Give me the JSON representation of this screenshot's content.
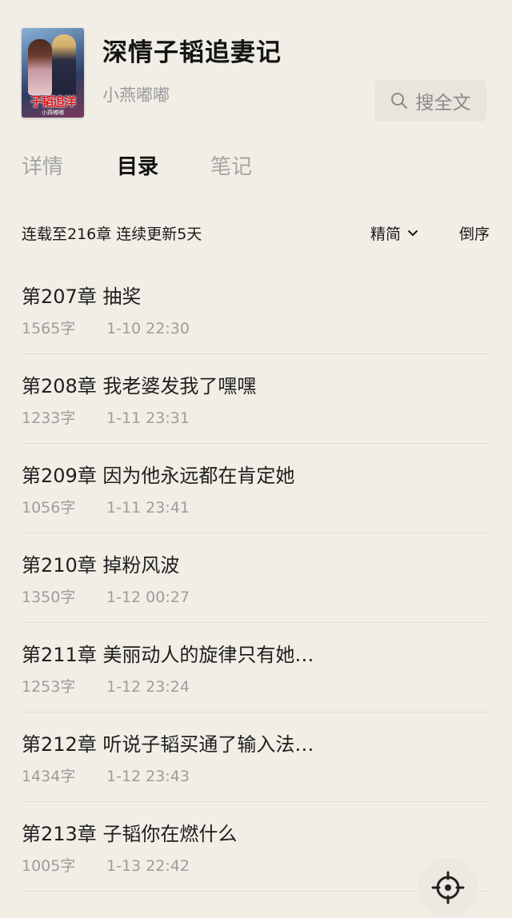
{
  "book": {
    "title": "深情子韬追妻记",
    "author": "小燕嘟嘟",
    "cover_title": "子韬追洋",
    "cover_subtitle": "小燕嘟嘟"
  },
  "search": {
    "label": "搜全文"
  },
  "tabs": [
    {
      "label": "详情",
      "active": false
    },
    {
      "label": "目录",
      "active": true
    },
    {
      "label": "笔记",
      "active": false
    }
  ],
  "toc_info": {
    "status": "连载至216章 连续更新5天",
    "mode": "精简",
    "order": "倒序"
  },
  "chapters": [
    {
      "title": "第207章  抽奖",
      "words": "1565字",
      "time": "1-10 22:30"
    },
    {
      "title": "第208章  我老婆发我了嘿嘿",
      "words": "1233字",
      "time": "1-11 23:31"
    },
    {
      "title": "第209章  因为他永远都在肯定她",
      "words": "1056字",
      "time": "1-11 23:41"
    },
    {
      "title": "第210章  掉粉风波",
      "words": "1350字",
      "time": "1-12 00:27"
    },
    {
      "title": "第211章  美丽动人的旋律只有她…",
      "words": "1253字",
      "time": "1-12 23:24"
    },
    {
      "title": "第212章  听说子韬买通了输入法…",
      "words": "1434字",
      "time": "1-12 23:43"
    },
    {
      "title": "第213章  子韬你在燃什么",
      "words": "1005字",
      "time": "1-13 22:42"
    }
  ],
  "icons": {
    "search": "search-icon",
    "dropdown": "chevron-down-icon",
    "locate": "crosshair-icon"
  }
}
